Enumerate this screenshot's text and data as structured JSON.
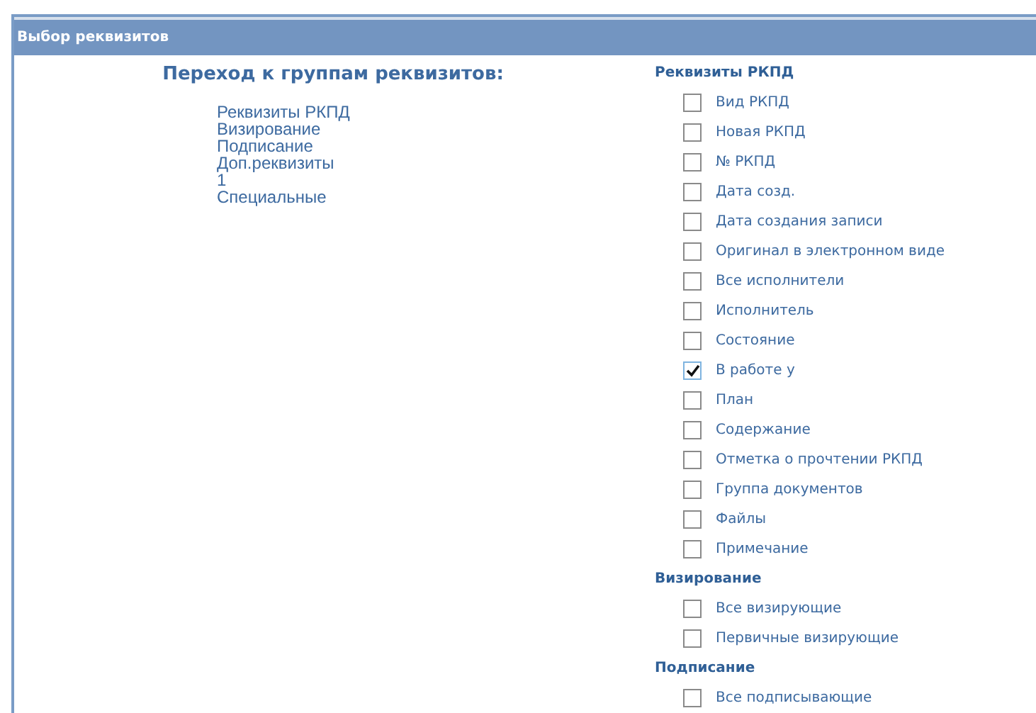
{
  "window": {
    "title": "Выбор реквизитов"
  },
  "navigation": {
    "title": "Переход к группам реквизитов:",
    "links": [
      "Реквизиты РКПД",
      "Визирование",
      "Подписание",
      "Доп.реквизиты",
      "1",
      "Специальные"
    ]
  },
  "groups": [
    {
      "title": "Реквизиты РКПД",
      "fields": [
        {
          "label": "Вид РКПД",
          "checked": false
        },
        {
          "label": "Новая РКПД",
          "checked": false
        },
        {
          "label": "№ РКПД",
          "checked": false
        },
        {
          "label": "Дата созд.",
          "checked": false
        },
        {
          "label": "Дата создания записи",
          "checked": false
        },
        {
          "label": "Оригинал в электронном виде",
          "checked": false
        },
        {
          "label": "Все исполнители",
          "checked": false
        },
        {
          "label": "Исполнитель",
          "checked": false
        },
        {
          "label": "Состояние",
          "checked": false
        },
        {
          "label": "В работе у",
          "checked": true
        },
        {
          "label": "План",
          "checked": false
        },
        {
          "label": "Содержание",
          "checked": false
        },
        {
          "label": "Отметка о прочтении РКПД",
          "checked": false
        },
        {
          "label": "Группа документов",
          "checked": false
        },
        {
          "label": "Файлы",
          "checked": false
        },
        {
          "label": "Примечание",
          "checked": false
        }
      ]
    },
    {
      "title": "Визирование",
      "fields": [
        {
          "label": "Все визирующие",
          "checked": false
        },
        {
          "label": "Первичные визирующие",
          "checked": false
        }
      ]
    },
    {
      "title": "Подписание",
      "fields": [
        {
          "label": "Все подписывающие",
          "checked": false
        }
      ]
    }
  ]
}
